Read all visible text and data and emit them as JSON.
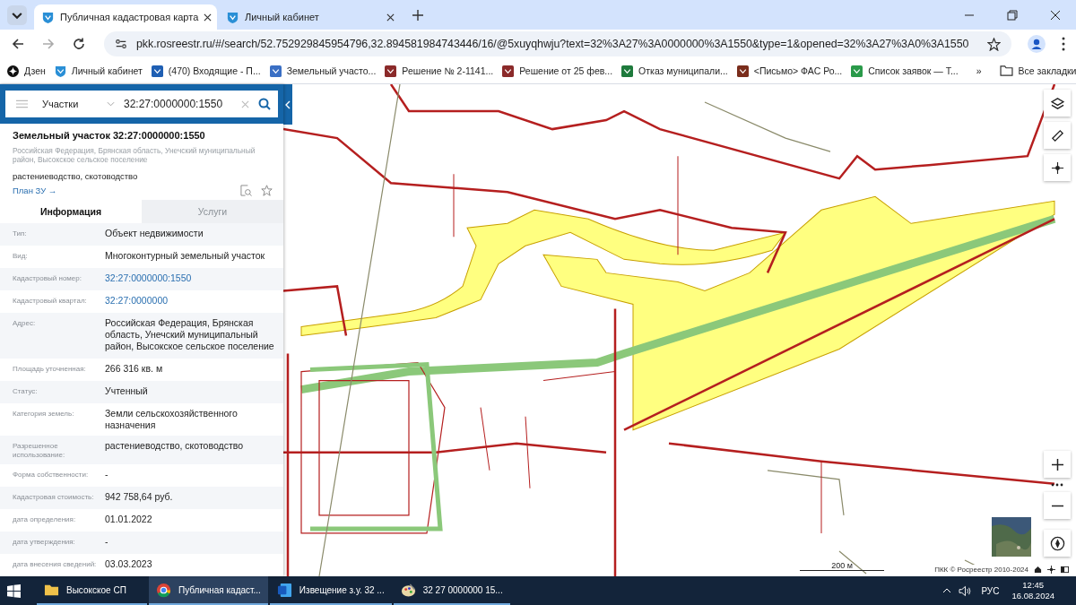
{
  "browser": {
    "tabs": [
      {
        "title": "Публичная кадастровая карта",
        "selected": true
      },
      {
        "title": "Личный кабинет",
        "selected": false
      }
    ],
    "url": "pkk.rosreestr.ru/#/search/52.752929845954796,32.894581984743446/16/@5xuyqhwju?text=32%3A27%3A0000000%3A1550&type=1&opened=32%3A27%3A0%3A1550",
    "bookmarks": [
      {
        "label": "Дзен",
        "kind": "zen"
      },
      {
        "label": "Личный кабинет",
        "kind": "emblem"
      },
      {
        "label": "(470) Входящие - П...",
        "kind": "mail"
      },
      {
        "label": "Земельный участо...",
        "kind": "eagle"
      },
      {
        "label": "Решение № 2-1141...",
        "kind": "court"
      },
      {
        "label": "Решение от 25 фев...",
        "kind": "court"
      },
      {
        "label": "Отказ муниципали...",
        "kind": "flag"
      },
      {
        "label": "<Письмо> ФАС Ро...",
        "kind": "seal"
      },
      {
        "label": "Список заявок — Т...",
        "kind": "gmail"
      }
    ],
    "more": "»",
    "all_bookmarks": "Все закладки"
  },
  "search": {
    "category": "Участки",
    "query": "32:27:0000000:1550"
  },
  "parcel": {
    "title": "Земельный участок 32:27:0000000:1550",
    "address": "Российская Федерация, Брянская область, Унечский муниципальный район, Высокское сельское поселение",
    "usage": "растениеводство, скотоводство",
    "plan_link": "План ЗУ →"
  },
  "info_tabs": [
    {
      "label": "Информация",
      "selected": true
    },
    {
      "label": "Услуги",
      "selected": false
    }
  ],
  "fields": [
    {
      "label": "Тип:",
      "value": "Объект недвижимости",
      "link": false
    },
    {
      "label": "Вид:",
      "value": "Многоконтурный земельный участок",
      "link": false
    },
    {
      "label": "Кадастровый номер:",
      "value": "32:27:0000000:1550",
      "link": true
    },
    {
      "label": "Кадастровый квартал:",
      "value": "32:27:0000000",
      "link": true
    },
    {
      "label": "Адрес:",
      "value": "Российская Федерация, Брянская область, Унечский муниципальный район, Высокское сельское поселение",
      "link": false
    },
    {
      "label": "Площадь уточненная:",
      "value": "266 316 кв. м",
      "link": false
    },
    {
      "label": "Статус:",
      "value": "Учтенный",
      "link": false
    },
    {
      "label": "Категория земель:",
      "value": "Земли сельскохозяйственного назначения",
      "link": false
    },
    {
      "label": "Разрешенное использование:",
      "value": "растениеводство, скотоводство",
      "link": false
    },
    {
      "label": "Форма собственности:",
      "value": "-",
      "link": false
    },
    {
      "label": "Кадастровая стоимость:",
      "value": "942 758,64 руб.",
      "link": false
    },
    {
      "label": "дата определения:",
      "value": "01.01.2022",
      "link": false
    },
    {
      "label": "дата утверждения:",
      "value": "-",
      "link": false
    },
    {
      "label": "дата внесения сведений:",
      "value": "03.03.2023",
      "link": false
    }
  ],
  "map": {
    "scale": "200 м",
    "copyright": "ПКК © Росреестр 2010-2024"
  },
  "taskbar": {
    "items": [
      {
        "label": "Высокское СП",
        "kind": "folder",
        "active": false
      },
      {
        "label": "Публичная кадаст...",
        "kind": "chrome",
        "active": true
      },
      {
        "label": "Извещение з.у. 32 ...",
        "kind": "word",
        "active": false
      },
      {
        "label": "32  27  0000000  15...",
        "kind": "paint",
        "active": false
      }
    ],
    "language": "РУС",
    "time": "12:45",
    "date": "16.08.2024"
  }
}
